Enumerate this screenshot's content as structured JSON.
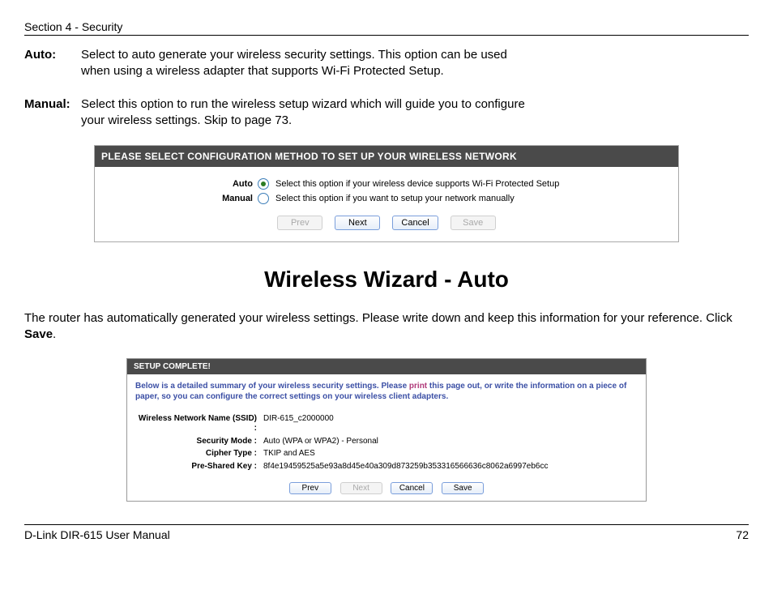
{
  "header": {
    "section": "Section 4 - Security"
  },
  "definitions": {
    "auto": {
      "term": "Auto:",
      "desc": "Select to auto generate your wireless security settings. This option can be used when using a wireless adapter that supports Wi-Fi Protected Setup."
    },
    "manual": {
      "term": "Manual:",
      "desc": "Select this option to run the wireless setup wizard which will guide you to configure your wireless settings. Skip to page 73."
    }
  },
  "panel1": {
    "title": "PLEASE SELECT CONFIGURATION METHOD TO SET UP YOUR WIRELESS NETWORK",
    "auto_label": "Auto",
    "auto_desc": "Select this option if your wireless device supports Wi-Fi Protected Setup",
    "manual_label": "Manual",
    "manual_desc": "Select this option if you want to setup your network manually",
    "buttons": {
      "prev": "Prev",
      "next": "Next",
      "cancel": "Cancel",
      "save": "Save"
    }
  },
  "page_title": "Wireless Wizard - Auto",
  "body_text_1": "The router has automatically generated your wireless settings. Please write down and keep this information for your reference. Click ",
  "body_text_save": "Save",
  "body_text_2": ".",
  "panel2": {
    "title": "SETUP COMPLETE!",
    "intro_1": "Below is a detailed summary of your wireless security settings. Please ",
    "intro_print": "print",
    "intro_2": " this page out, or write the information on a piece of paper, so you can configure the correct settings on your wireless client adapters.",
    "fields": {
      "ssid_label": "Wireless Network Name (SSID) :",
      "ssid_value": "DIR-615_c2000000",
      "secmode_label": "Security Mode :",
      "secmode_value": "Auto (WPA or WPA2) - Personal",
      "cipher_label": "Cipher Type :",
      "cipher_value": "TKIP and AES",
      "psk_label": "Pre-Shared Key :",
      "psk_value": "8f4e19459525a5e93a8d45e40a309d873259b353316566636c8062a6997eb6cc"
    },
    "buttons": {
      "prev": "Prev",
      "next": "Next",
      "cancel": "Cancel",
      "save": "Save"
    }
  },
  "footer": {
    "manual": "D-Link DIR-615 User Manual",
    "page": "72"
  }
}
